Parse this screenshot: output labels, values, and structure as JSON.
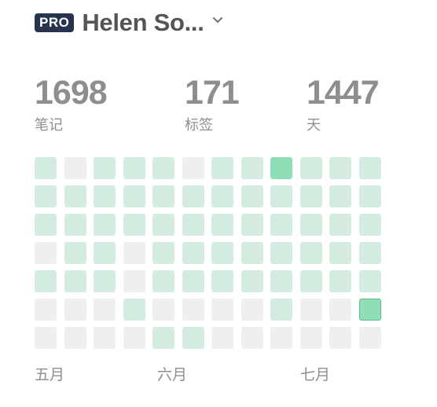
{
  "header": {
    "badge": "PRO",
    "user_name": "Helen So...",
    "dropdown_icon": "chevron-down-icon"
  },
  "stats": {
    "notes": {
      "value": "1698",
      "label": "笔记"
    },
    "tags": {
      "value": "171",
      "label": "标签"
    },
    "days": {
      "value": "1447",
      "label": "天"
    }
  },
  "heatmap": {
    "colors": {
      "level_0": "#efefef",
      "level_1": "#d4ecdf",
      "level_2": "#8fdeb5",
      "today_border": "#5fbf8c"
    },
    "today": {
      "week": 11,
      "day": 5
    },
    "weeks": [
      [
        1,
        1,
        1,
        0,
        1,
        0,
        0
      ],
      [
        0,
        1,
        1,
        1,
        1,
        0,
        0
      ],
      [
        1,
        1,
        1,
        1,
        1,
        0,
        0
      ],
      [
        1,
        1,
        1,
        0,
        0,
        1,
        0
      ],
      [
        1,
        1,
        1,
        1,
        1,
        0,
        1
      ],
      [
        0,
        1,
        1,
        1,
        1,
        0,
        1
      ],
      [
        1,
        1,
        1,
        1,
        1,
        0,
        0
      ],
      [
        1,
        1,
        1,
        1,
        1,
        0,
        0
      ],
      [
        2,
        1,
        1,
        1,
        1,
        1,
        0
      ],
      [
        1,
        1,
        1,
        1,
        1,
        0,
        0
      ],
      [
        1,
        1,
        1,
        1,
        1,
        0,
        0
      ],
      [
        1,
        1,
        1,
        1,
        1,
        2,
        0
      ]
    ]
  },
  "months": [
    "五月",
    "六月",
    "七月"
  ]
}
